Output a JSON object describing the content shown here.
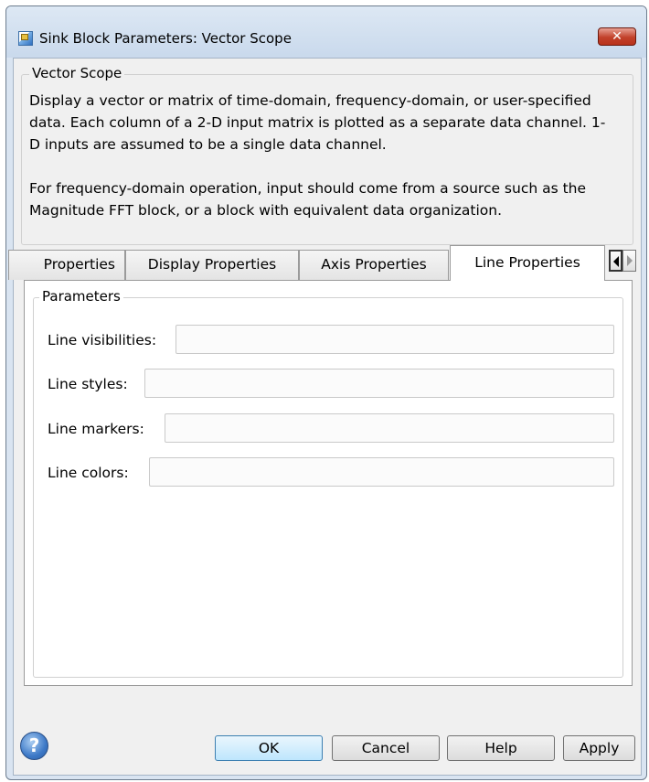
{
  "window": {
    "title": "Sink Block Parameters: Vector Scope",
    "close_glyph": "✕"
  },
  "block_group": {
    "title": "Vector Scope",
    "description": [
      "Display a vector or matrix of time-domain, frequency-domain, or user-specified data.  Each column of a 2-D input matrix is plotted as a separate data channel.  1-D inputs are assumed to be a single data channel.",
      "For frequency-domain operation, input should come from a source such as the Magnitude FFT block, or a block with equivalent data organization."
    ]
  },
  "tabs": [
    {
      "label": "Properties",
      "active": false
    },
    {
      "label": "Display Properties",
      "active": false
    },
    {
      "label": "Axis Properties",
      "active": false
    },
    {
      "label": "Line Properties",
      "active": true
    }
  ],
  "parameters": {
    "title": "Parameters",
    "fields": [
      {
        "label": "Line visibilities:",
        "value": ""
      },
      {
        "label": "Line styles:",
        "value": ""
      },
      {
        "label": "Line markers:",
        "value": ""
      },
      {
        "label": "Line colors:",
        "value": ""
      }
    ]
  },
  "help_glyph": "?",
  "buttons": {
    "ok": "OK",
    "cancel": "Cancel",
    "help": "Help",
    "apply": "Apply"
  },
  "colors": {
    "frame": "#d9e4f1",
    "panel": "#f0f0f0",
    "close": "#c2412a",
    "default_button": "#bee6fd"
  },
  "icons": [
    "simulink-block-icon",
    "close-icon",
    "scroll-left-icon",
    "scroll-right-icon",
    "help-icon"
  ]
}
